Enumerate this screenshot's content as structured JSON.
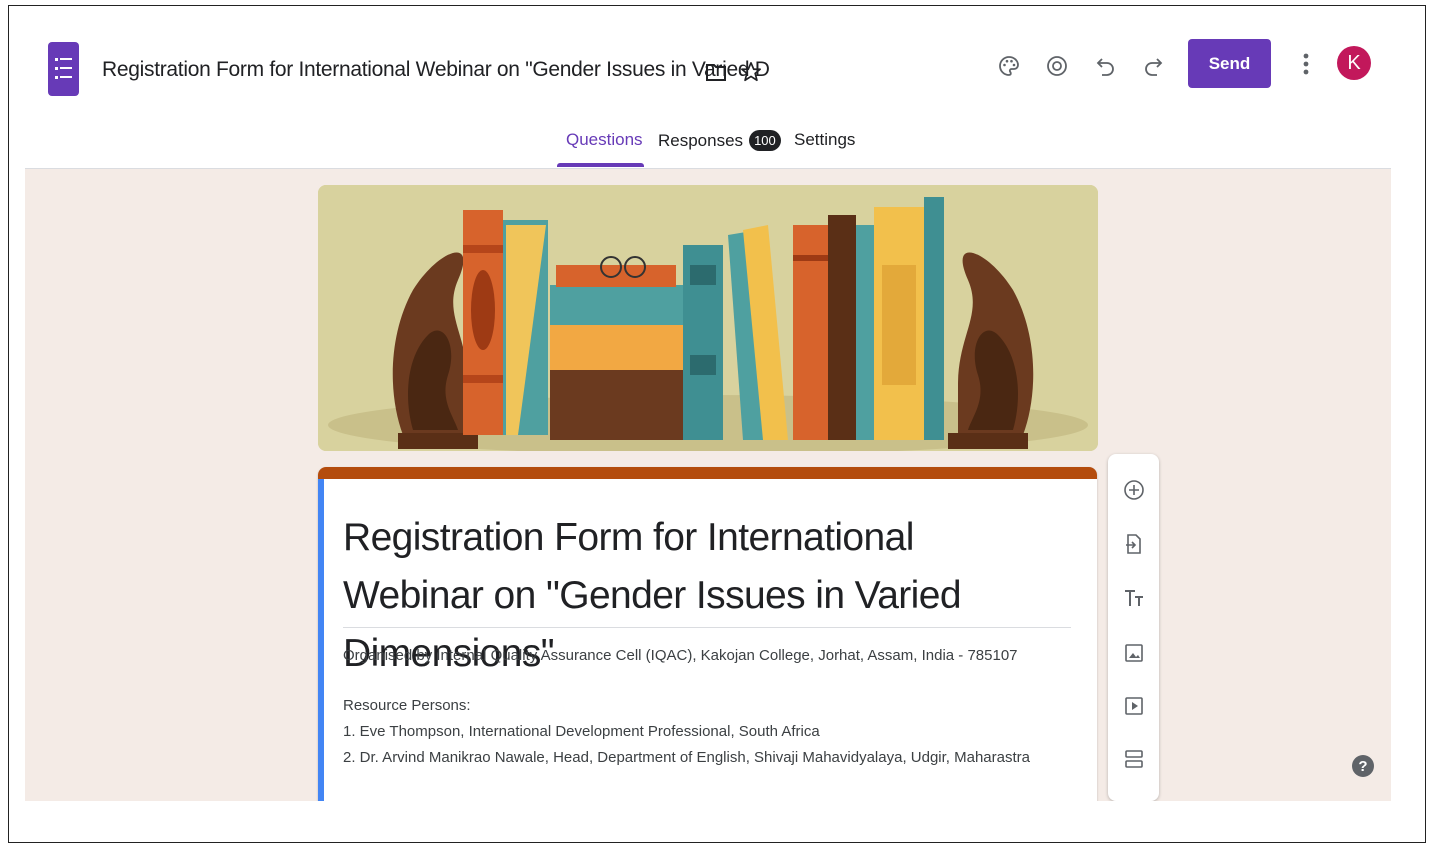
{
  "header": {
    "doc_title": "Registration Form for International Webinar on \"Gender Issues in Varied D",
    "send_label": "Send",
    "avatar_initial": "K",
    "icons": [
      "forms-logo",
      "folder-icon",
      "star-icon",
      "palette-icon",
      "preview-eye-icon",
      "undo-icon",
      "redo-icon",
      "more-vert-icon"
    ]
  },
  "tabs": {
    "questions": "Questions",
    "responses": "Responses",
    "responses_count": "100",
    "settings": "Settings",
    "active": "questions"
  },
  "form": {
    "title": "Registration Form for International Webinar on \"Gender Issues in Varied Dimensions\"",
    "organiser": "Organised by Internal Quality Assurance Cell (IQAC), Kakojan College, Jorhat, Assam, India - 785107",
    "resource_heading": "Resource Persons:",
    "resource_1": "1. Eve Thompson, International Development Professional, South Africa",
    "resource_2": "2. Dr. Arvind Manikrao Nawale, Head, Department of English, Shivaji Mahavidyalaya, Udgir, Maharastra"
  },
  "side_toolbar": [
    "add-question-icon",
    "import-questions-icon",
    "add-title-icon",
    "add-image-icon",
    "add-video-icon",
    "add-section-icon"
  ],
  "help_label": "?",
  "colors": {
    "accent": "#673ab7",
    "theme_header": "#b44c0d",
    "canvas_bg": "#f4ebe6",
    "avatar_bg": "#c2185b"
  }
}
